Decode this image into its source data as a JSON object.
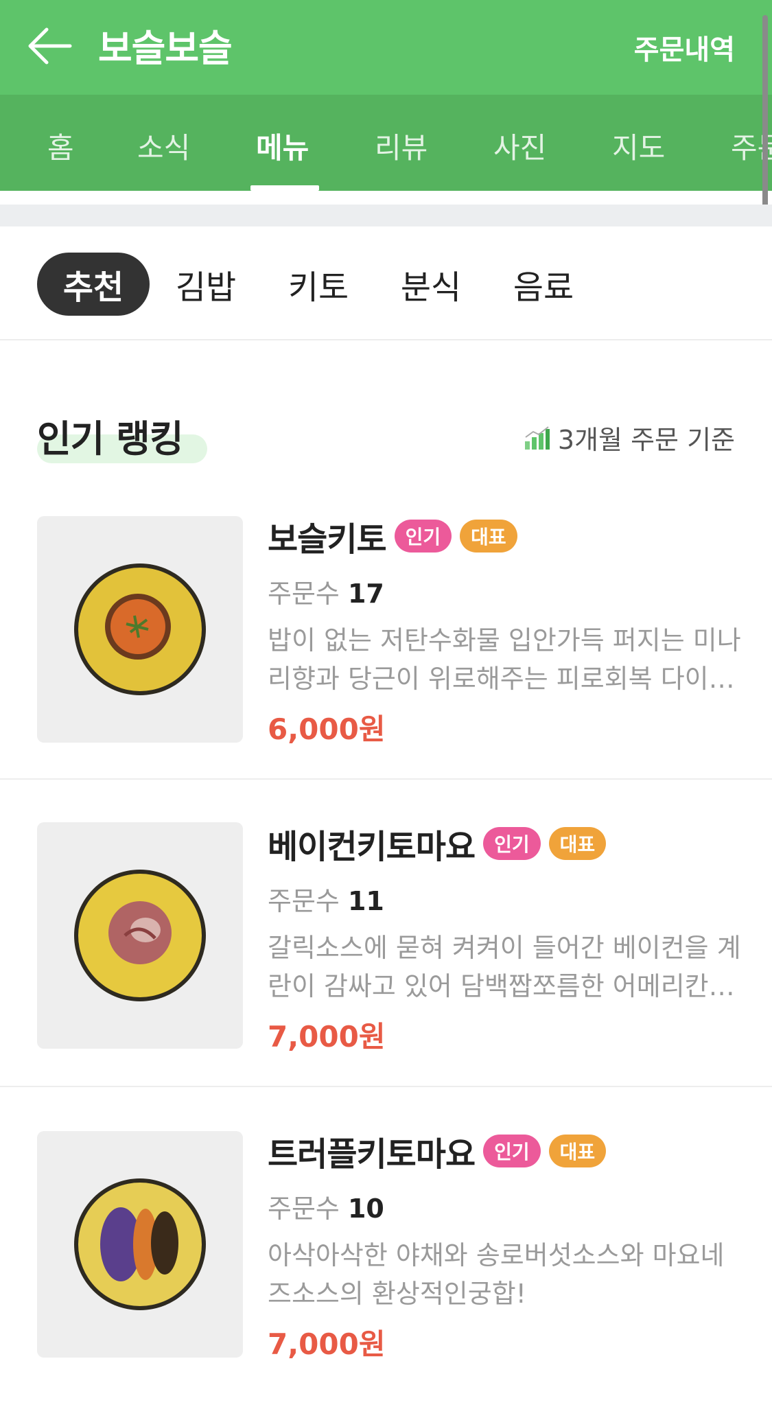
{
  "header": {
    "title": "보슬보슬",
    "order_history": "주문내역",
    "tabs": [
      "홈",
      "소식",
      "메뉴",
      "리뷰",
      "사진",
      "지도",
      "주문"
    ],
    "active_tab": "메뉴"
  },
  "categories": {
    "items": [
      "추천",
      "김밥",
      "키토",
      "분식",
      "음료"
    ],
    "active": "추천"
  },
  "ranking": {
    "title": "인기 랭킹",
    "basis": "3개월 주문 기준"
  },
  "badges": {
    "popular": "인기",
    "representative": "대표"
  },
  "colors": {
    "header_green": "#5ec46a",
    "tab_green": "#55b35e",
    "price_red": "#e85a45",
    "badge_pink": "#ec5a9a",
    "badge_orange": "#f0a33a"
  },
  "menu_items": [
    {
      "name": "보슬키토",
      "orders_label": "주문수",
      "orders_count": "17",
      "description": "밥이 없는 저탄수화물 입안가득 퍼지는 미나리향과 당근이 위로해주는 피로회복 다이어트 김밥",
      "price": "6,000원"
    },
    {
      "name": "베이컨키토마요",
      "orders_label": "주문수",
      "orders_count": "11",
      "description": "갈릭소스에 묻혀 켜켜이 들어간 베이컨을 계란이 감싸고 있어 담백짭쪼름한 어메리칸 스타일",
      "price": "7,000원"
    },
    {
      "name": "트러플키토마요",
      "orders_label": "주문수",
      "orders_count": "10",
      "description": "아삭아삭한 야채와 송로버섯소스와 마요네즈소스의 환상적인궁합!",
      "price": "7,000원"
    }
  ]
}
